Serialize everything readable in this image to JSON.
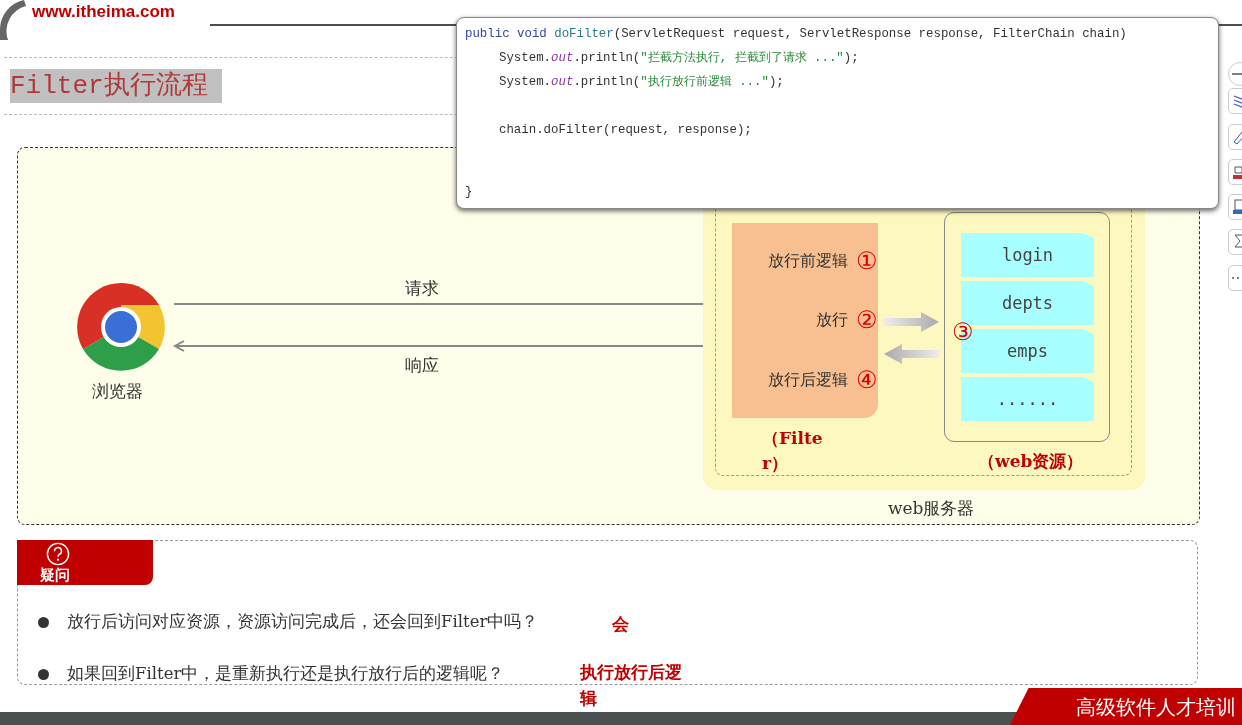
{
  "logo": {
    "url": "www.itheima.com"
  },
  "title": "Filter执行流程",
  "diagram": {
    "browser": {
      "label": "浏览器"
    },
    "request": "请求",
    "response": "响应",
    "server": {
      "label": "web服务器",
      "filter": {
        "caption": "（Filter）",
        "steps": [
          {
            "text": "放行前逻辑",
            "num": "①"
          },
          {
            "text": "放行",
            "num": "②"
          },
          {
            "text": "放行后逻辑",
            "num": "④"
          }
        ]
      },
      "resources": {
        "step": "③",
        "caption": "（web资源）",
        "items": [
          "login",
          "depts",
          "emps",
          "......"
        ]
      }
    }
  },
  "code_popup": {
    "lines": [
      {
        "indent": false,
        "blank_before": false,
        "tokens": [
          {
            "kind": "keyword",
            "text": "public void "
          },
          {
            "kind": "method",
            "text": "doFilter"
          },
          {
            "kind": "plain",
            "text": "(ServletRequest request, ServletResponse response, FilterChain chain)"
          }
        ]
      },
      {
        "indent": true,
        "blank_before": false,
        "tokens": [
          {
            "kind": "plain",
            "text": "System."
          },
          {
            "kind": "field",
            "text": "out"
          },
          {
            "kind": "plain",
            "text": ".println("
          },
          {
            "kind": "string",
            "text": "\"拦截方法执行, 拦截到了请求 ...\""
          },
          {
            "kind": "plain",
            "text": ");"
          }
        ]
      },
      {
        "indent": true,
        "blank_before": false,
        "tokens": [
          {
            "kind": "plain",
            "text": "System."
          },
          {
            "kind": "field",
            "text": "out"
          },
          {
            "kind": "plain",
            "text": ".println("
          },
          {
            "kind": "string",
            "text": "\"执行放行前逻辑 ...\""
          },
          {
            "kind": "plain",
            "text": ");"
          }
        ]
      },
      {
        "indent": true,
        "blank_before": true,
        "tokens": [
          {
            "kind": "plain",
            "text": "chain.doFilter(request, response);"
          }
        ]
      }
    ],
    "closing": "}"
  },
  "question": {
    "tab": "疑问",
    "items": [
      {
        "text": "放行后访问对应资源，资源访问完成后，还会回到Filter中吗？",
        "answer": "会"
      },
      {
        "text": "如果回到Filter中，是重新执行还是执行放行后的逻辑呢？",
        "answer": "执行放行后逻辑"
      }
    ]
  },
  "footer": {
    "banner": "高级软件人才培训"
  }
}
